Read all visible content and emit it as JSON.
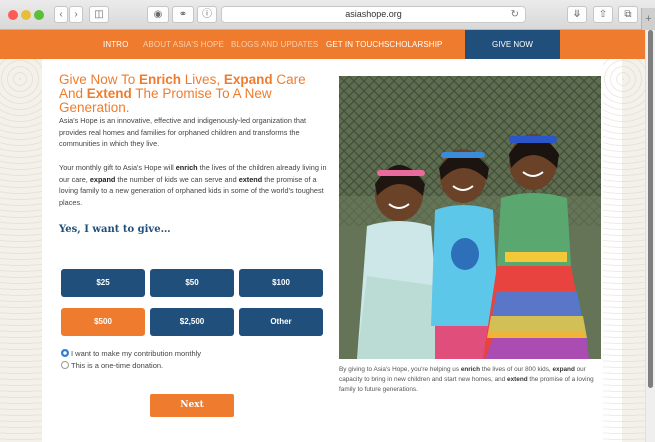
{
  "browser": {
    "url": "asiashope.org",
    "new_tab": "+"
  },
  "nav": {
    "items": [
      "INTRO",
      "ABOUT ASIA'S HOPE",
      "BLOGS AND UPDATES",
      "GET IN TOUCH",
      "SCHOLARSHIP"
    ],
    "give_now": "GIVE NOW"
  },
  "hero": {
    "headline_parts": [
      "Give Now To ",
      "Enrich",
      " Lives, ",
      "Expand",
      " Care And ",
      "Extend",
      " The Promise To A New Generation."
    ]
  },
  "intro": {
    "p1": "Asia's Hope is an innovative, effective and indigenously-led organization that provides real homes and families for orphaned children and transforms the communities in which they live.",
    "p2_parts": [
      "Your monthly gift to Asia's Hope will ",
      "enrich",
      " the lives of the children already living in our care, ",
      "expand",
      " the number of kids we can serve and ",
      "extend",
      " the promise of a loving family to a new generation of orphaned kids in some of the world's toughest places."
    ]
  },
  "give": {
    "title": "Yes, I want to give…",
    "amounts": [
      "$25",
      "$50",
      "$100",
      "$500",
      "$2,500",
      "Other"
    ],
    "selected_amount": "$500",
    "monthly_label": "I want to make my contribution monthly",
    "onetime_label": "This is a one-time donation.",
    "selected_option": "monthly",
    "next_label": "Next"
  },
  "caption": {
    "parts": [
      "By giving to Asia's Hope, you're helping us ",
      "enrich",
      " the lives of our 800 kids, ",
      "expand",
      " our capacity to bring in new children and start new homes, and ",
      "extend",
      " the promise of a loving family to future generations."
    ]
  },
  "colors": {
    "accent_orange": "#ef7c2e",
    "navy": "#1f4f7a"
  }
}
